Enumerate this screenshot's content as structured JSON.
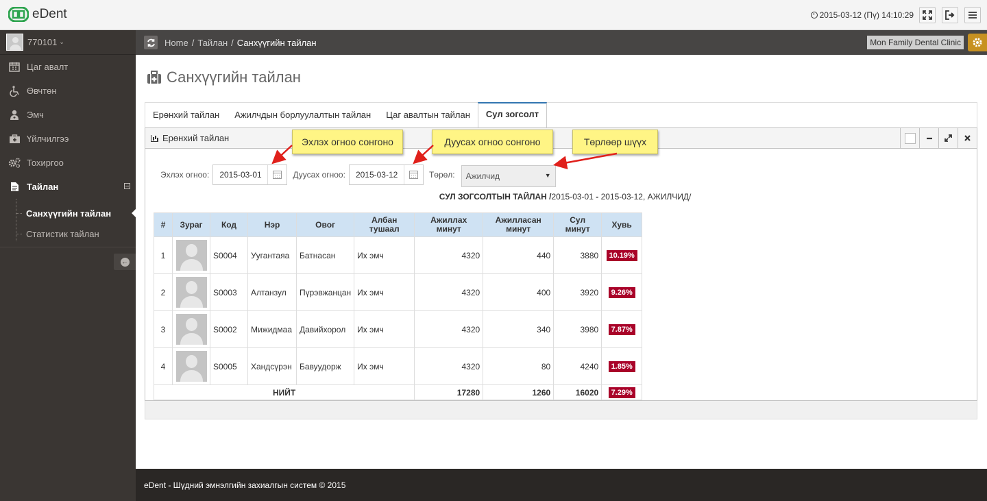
{
  "app": {
    "name": "eDent"
  },
  "header": {
    "datetime": "2015-03-12 (Пү) 14:10:29",
    "icons": [
      "fullscreen-icon",
      "logout-icon",
      "menu-icon"
    ]
  },
  "user": {
    "name": "770101"
  },
  "sidebar": {
    "items": [
      {
        "label": "Цаг авалт",
        "icon": "calendar-icon"
      },
      {
        "label": "Өвчтөн",
        "icon": "wheelchair-icon"
      },
      {
        "label": "Эмч",
        "icon": "user-md-icon"
      },
      {
        "label": "Үйлчилгээ",
        "icon": "medkit-icon"
      },
      {
        "label": "Тохиргоо",
        "icon": "gears-icon"
      },
      {
        "label": "Тайлан",
        "icon": "file-icon"
      }
    ],
    "subitems": [
      {
        "label": "Санхүүгийн тайлан"
      },
      {
        "label": "Статистик тайлан"
      }
    ]
  },
  "breadcrumb": {
    "items": [
      "Home",
      "Тайлан",
      "Санхүүгийн тайлан"
    ],
    "separator": "/"
  },
  "clinic": "Mon Family Dental Clinic",
  "page": {
    "title": "Санхүүгийн тайлан"
  },
  "tabs": [
    "Ерөнхий тайлан",
    "Ажилчдын борлуулалтын тайлан",
    "Цаг авалтын тайлан",
    "Сул зогсолт"
  ],
  "widget": {
    "title": "Ерөнхий тайлан"
  },
  "filters": {
    "start_label": "Эхлэх огноо:",
    "start_value": "2015-03-01",
    "end_label": "Дуусах огноо:",
    "end_value": "2015-03-12",
    "type_label": "Төрөл:",
    "type_value": "Ажилчид"
  },
  "report": {
    "title_bold": "СУЛ ЗОГСОЛТЫН ТАЙЛАН /",
    "title_range": "2015-03-01",
    "title_dash": "-",
    "title_rest": "2015-03-12, АЖИЛЧИД/"
  },
  "table": {
    "headers": [
      "#",
      "Зураг",
      "Код",
      "Нэр",
      "Овог",
      "Албан тушаал",
      "Ажиллах минут",
      "Ажилласан минут",
      "Сул минут",
      "Хувь"
    ],
    "rows": [
      {
        "n": "1",
        "code": "S0004",
        "name": "Уугантаяа",
        "surname": "Батнасан",
        "position": "Их эмч",
        "work": "4320",
        "worked": "440",
        "idle": "3880",
        "pct": "10.19%"
      },
      {
        "n": "2",
        "code": "S0003",
        "name": "Алтанзул",
        "surname": "Пүрэвжанцан",
        "position": "Их эмч",
        "work": "4320",
        "worked": "400",
        "idle": "3920",
        "pct": "9.26%"
      },
      {
        "n": "3",
        "code": "S0002",
        "name": "Мижидмаа",
        "surname": "Давийхорол",
        "position": "Их эмч",
        "work": "4320",
        "worked": "340",
        "idle": "3980",
        "pct": "7.87%"
      },
      {
        "n": "4",
        "code": "S0005",
        "name": "Хандсүрэн",
        "surname": "Бавуудорж",
        "position": "Их эмч",
        "work": "4320",
        "worked": "80",
        "idle": "4240",
        "pct": "1.85%"
      }
    ],
    "total": {
      "label": "НИЙТ",
      "work": "17280",
      "worked": "1260",
      "idle": "16020",
      "pct": "7.29%"
    }
  },
  "callouts": {
    "start": "Эхлэх огноо сонгоно",
    "end": "Дуусах огноо сонгоно",
    "type": "Төрлөөр шүүх"
  },
  "footer": {
    "text": "eDent - Шүдний эмнэлгийн захиалгын систем © 2015"
  },
  "colors": {
    "accent_badge": "#a90329",
    "header_cell": "#cfe2f3",
    "sidebar": "#3a3633",
    "gear": "#c79121",
    "callout": "#fff585",
    "arrow": "#e0201b"
  }
}
